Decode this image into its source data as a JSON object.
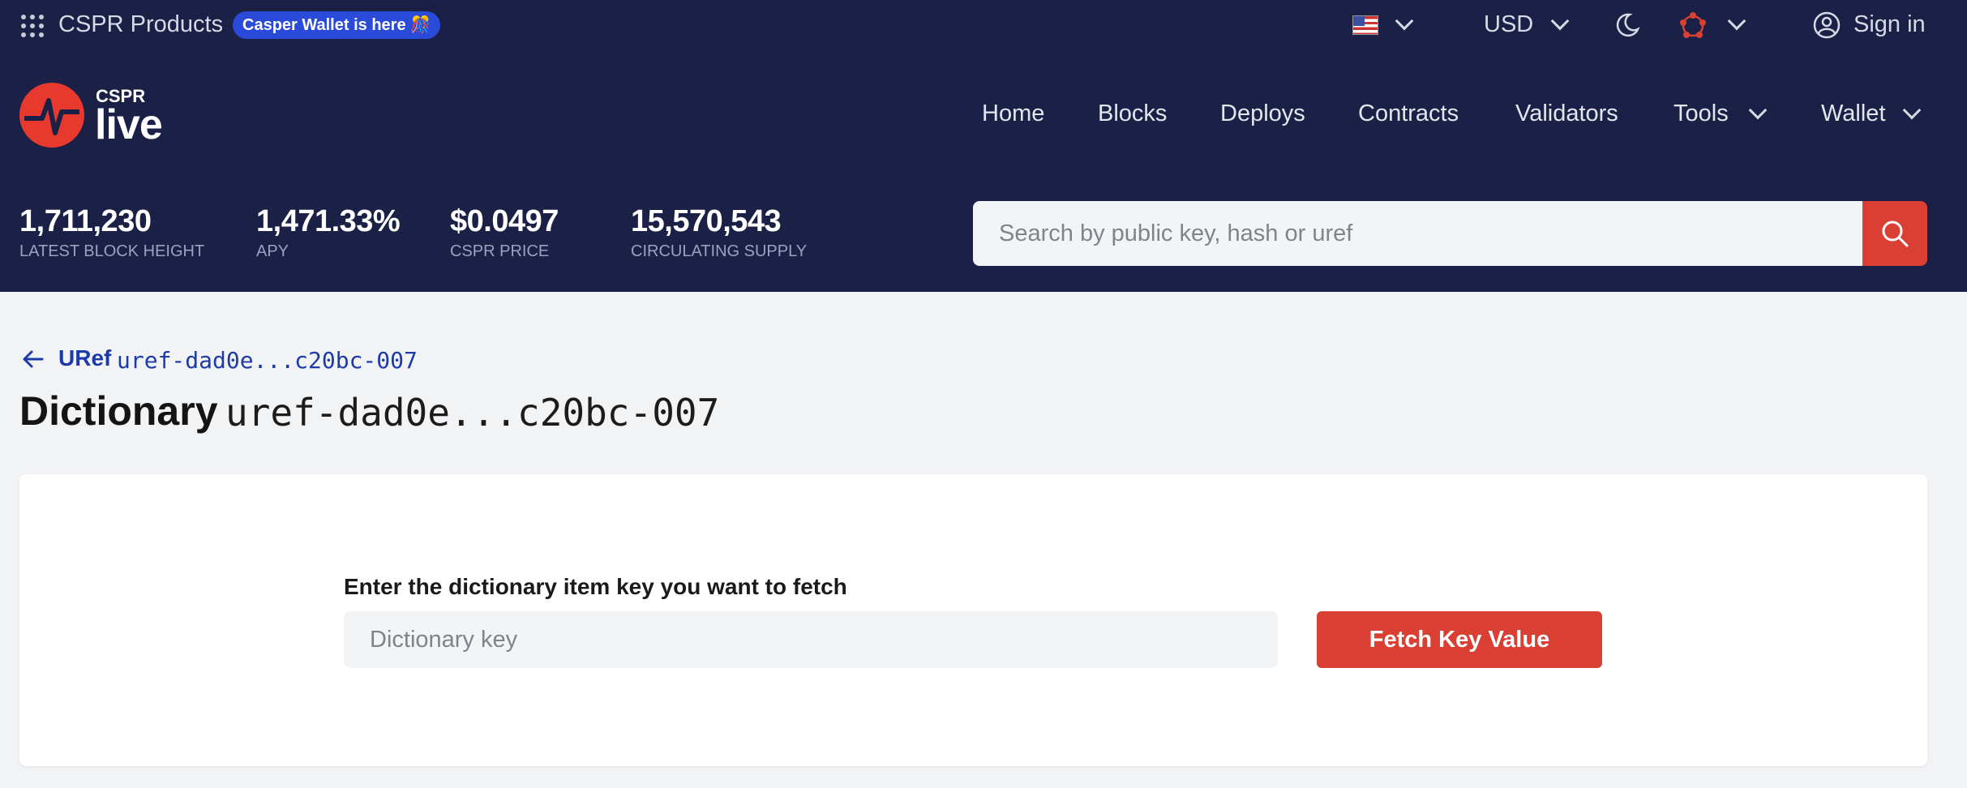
{
  "topbar": {
    "products_label": "CSPR Products",
    "promo_label": "Casper Wallet is here 🎊",
    "currency": "USD",
    "signin_label": "Sign in"
  },
  "logo": {
    "small": "CSPR",
    "large": "live"
  },
  "nav": {
    "home": "Home",
    "blocks": "Blocks",
    "deploys": "Deploys",
    "contracts": "Contracts",
    "validators": "Validators",
    "tools": "Tools",
    "wallet": "Wallet"
  },
  "stats": [
    {
      "value": "1,711,230",
      "label": "LATEST BLOCK HEIGHT"
    },
    {
      "value": "1,471.33%",
      "label": "APY"
    },
    {
      "value": "$0.0497",
      "label": "CSPR PRICE"
    },
    {
      "value": "15,570,543",
      "label": "CIRCULATING SUPPLY"
    }
  ],
  "search": {
    "placeholder": "Search by public key, hash or uref"
  },
  "breadcrumb": {
    "label": "URef",
    "value": "uref-dad0e...c20bc-007"
  },
  "page": {
    "title": "Dictionary",
    "title_value": "uref-dad0e...c20bc-007"
  },
  "form": {
    "label": "Enter the dictionary item key you want to fetch",
    "placeholder": "Dictionary key",
    "value": "",
    "button": "Fetch Key Value"
  },
  "colors": {
    "header_bg": "#1b2046",
    "accent": "#d93f32",
    "link": "#1c3aa8"
  }
}
